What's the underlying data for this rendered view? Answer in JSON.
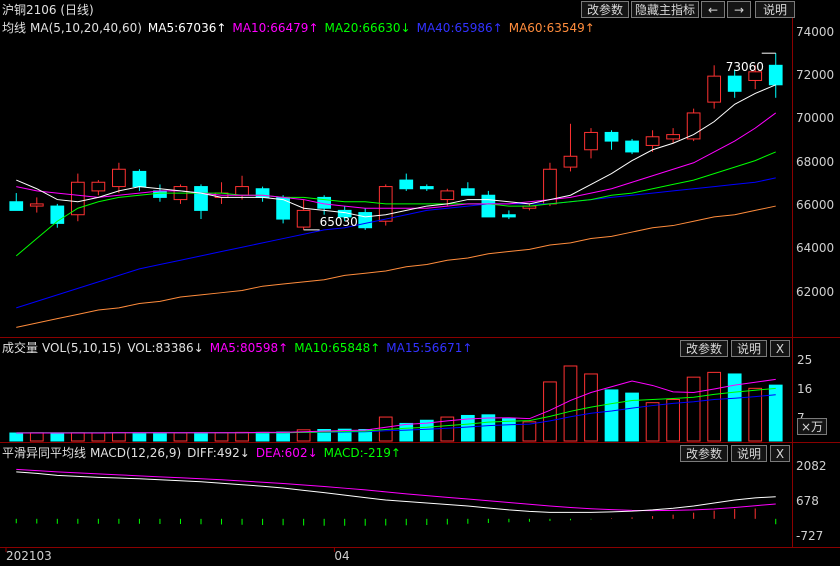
{
  "header": {
    "title": "沪铜2106 (日线)",
    "buttons": {
      "params": "改参数",
      "hide_main": "隐藏主指标",
      "prev": "←",
      "next": "→",
      "help": "说明"
    }
  },
  "price_panel": {
    "ma_legend": {
      "label": "均线",
      "name": "MA(5,10,20,40,60)",
      "ma5": "MA5:67036↑",
      "ma10": "MA10:66479↑",
      "ma20": "MA20:66630↓",
      "ma40": "MA40:65986↑",
      "ma60": "MA60:63549↑"
    },
    "y_ticks": [
      "74000",
      "72000",
      "70000",
      "68000",
      "66000",
      "64000",
      "62000"
    ],
    "annotations": {
      "high": "73060",
      "low": "65030"
    }
  },
  "volume_panel": {
    "legend": {
      "label": "成交量",
      "name": "VOL(5,10,15)",
      "vol": "VOL:83386↓",
      "ma5": "MA5:80598↑",
      "ma10": "MA10:65848↑",
      "ma15": "MA15:56671↑"
    },
    "buttons": {
      "params": "改参数",
      "help": "说明",
      "close": "X"
    },
    "y_ticks": [
      "25",
      "16",
      "7"
    ],
    "unit": "×万"
  },
  "macd_panel": {
    "legend": {
      "label": "平滑异同平均线",
      "name": "MACD(12,26,9)",
      "diff": "DIFF:492↓",
      "dea": "DEA:602↓",
      "macd": "MACD:-219↑"
    },
    "buttons": {
      "params": "改参数",
      "help": "说明",
      "close": "X"
    },
    "y_ticks": [
      "2082",
      "678",
      "-727"
    ]
  },
  "x_axis": {
    "labels": [
      "202103",
      "04"
    ]
  },
  "colors": {
    "up": "#ff3232",
    "down": "#00ffff",
    "ma5": "#ffffff",
    "ma10": "#ff00ff",
    "ma20": "#00ff00",
    "ma40": "#0000ff",
    "ma60": "#ff8c3c",
    "grid": "#8a0000"
  },
  "chart_data": {
    "type": "candlestick",
    "title": "沪铜2106 (日线)",
    "y_range": [
      60000,
      74500
    ],
    "candles": [
      {
        "o": 66200,
        "h": 66600,
        "l": 65800,
        "c": 65800
      },
      {
        "o": 66000,
        "h": 66400,
        "l": 65700,
        "c": 66100
      },
      {
        "o": 66000,
        "h": 66100,
        "l": 65000,
        "c": 65200
      },
      {
        "o": 65600,
        "h": 67500,
        "l": 65300,
        "c": 67100
      },
      {
        "o": 66700,
        "h": 67200,
        "l": 66500,
        "c": 67100
      },
      {
        "o": 66900,
        "h": 68000,
        "l": 66600,
        "c": 67700
      },
      {
        "o": 67600,
        "h": 67700,
        "l": 66700,
        "c": 66900
      },
      {
        "o": 66700,
        "h": 67000,
        "l": 66200,
        "c": 66400
      },
      {
        "o": 66300,
        "h": 67000,
        "l": 66100,
        "c": 66900
      },
      {
        "o": 66900,
        "h": 67000,
        "l": 65400,
        "c": 65800
      },
      {
        "o": 66400,
        "h": 67100,
        "l": 66100,
        "c": 66600
      },
      {
        "o": 66500,
        "h": 67400,
        "l": 66300,
        "c": 66900
      },
      {
        "o": 66800,
        "h": 66900,
        "l": 66200,
        "c": 66400
      },
      {
        "o": 66400,
        "h": 66500,
        "l": 65200,
        "c": 65400
      },
      {
        "o": 65030,
        "h": 66300,
        "l": 64900,
        "c": 65800
      },
      {
        "o": 66400,
        "h": 66500,
        "l": 65600,
        "c": 65900
      },
      {
        "o": 65800,
        "h": 66000,
        "l": 65300,
        "c": 65500
      },
      {
        "o": 65700,
        "h": 65900,
        "l": 64900,
        "c": 65000
      },
      {
        "o": 65300,
        "h": 67000,
        "l": 65100,
        "c": 66900
      },
      {
        "o": 67200,
        "h": 67500,
        "l": 66700,
        "c": 66800
      },
      {
        "o": 66900,
        "h": 67000,
        "l": 66700,
        "c": 66800
      },
      {
        "o": 66300,
        "h": 66800,
        "l": 66000,
        "c": 66700
      },
      {
        "o": 66800,
        "h": 67100,
        "l": 66500,
        "c": 66500
      },
      {
        "o": 66500,
        "h": 66700,
        "l": 65500,
        "c": 65500
      },
      {
        "o": 65600,
        "h": 65800,
        "l": 65400,
        "c": 65500
      },
      {
        "o": 65900,
        "h": 66100,
        "l": 65800,
        "c": 66000
      },
      {
        "o": 66100,
        "h": 68000,
        "l": 66000,
        "c": 67700
      },
      {
        "o": 67800,
        "h": 69800,
        "l": 67600,
        "c": 68300
      },
      {
        "o": 68600,
        "h": 69600,
        "l": 68200,
        "c": 69400
      },
      {
        "o": 69400,
        "h": 69500,
        "l": 68600,
        "c": 69000
      },
      {
        "o": 69000,
        "h": 69100,
        "l": 68400,
        "c": 68500
      },
      {
        "o": 68800,
        "h": 69500,
        "l": 68500,
        "c": 69200
      },
      {
        "o": 69100,
        "h": 69600,
        "l": 68900,
        "c": 69300
      },
      {
        "o": 69100,
        "h": 70500,
        "l": 69000,
        "c": 70300
      },
      {
        "o": 70800,
        "h": 72500,
        "l": 70500,
        "c": 72000
      },
      {
        "o": 72000,
        "h": 72300,
        "l": 71000,
        "c": 71300
      },
      {
        "o": 71800,
        "h": 72500,
        "l": 71400,
        "c": 72200
      },
      {
        "o": 72500,
        "h": 73060,
        "l": 71000,
        "c": 71600
      }
    ],
    "ma5": [
      67200,
      66800,
      66300,
      66200,
      66400,
      66700,
      66900,
      66800,
      66700,
      66600,
      66400,
      66400,
      66400,
      66300,
      65900,
      65800,
      65700,
      65500,
      65600,
      65800,
      66000,
      66100,
      66300,
      66300,
      66200,
      66100,
      66300,
      66500,
      67000,
      67500,
      68100,
      68600,
      68900,
      69300,
      69900,
      70700,
      71200,
      71600
    ],
    "ma10": [
      66900,
      66700,
      66600,
      66500,
      66400,
      66500,
      66600,
      66700,
      66700,
      66600,
      66500,
      66500,
      66500,
      66400,
      66300,
      66100,
      66000,
      65900,
      65900,
      65900,
      65900,
      66000,
      66100,
      66100,
      66100,
      66200,
      66300,
      66400,
      66600,
      66800,
      67100,
      67400,
      67700,
      68000,
      68500,
      69000,
      69600,
      70300
    ],
    "ma20": [
      63700,
      64500,
      65300,
      65900,
      66200,
      66400,
      66500,
      66600,
      66600,
      66600,
      66600,
      66500,
      66500,
      66400,
      66400,
      66300,
      66200,
      66200,
      66100,
      66100,
      66100,
      66100,
      66100,
      66100,
      66000,
      66000,
      66100,
      66200,
      66300,
      66500,
      66600,
      66800,
      67000,
      67200,
      67500,
      67800,
      68100,
      68500
    ],
    "ma40": [
      61300,
      61600,
      61900,
      62200,
      62500,
      62800,
      63100,
      63300,
      63500,
      63700,
      63900,
      64100,
      64300,
      64500,
      64700,
      64900,
      65000,
      65200,
      65400,
      65600,
      65800,
      65900,
      66000,
      66100,
      66100,
      66100,
      66100,
      66200,
      66300,
      66400,
      66500,
      66600,
      66700,
      66800,
      66900,
      67000,
      67100,
      67300
    ],
    "ma60": [
      60400,
      60600,
      60800,
      61000,
      61200,
      61300,
      61500,
      61600,
      61800,
      61900,
      62000,
      62100,
      62300,
      62400,
      62500,
      62600,
      62800,
      62900,
      63000,
      63200,
      63300,
      63500,
      63600,
      63800,
      63900,
      64000,
      64200,
      64300,
      64500,
      64600,
      64800,
      65000,
      65100,
      65300,
      65500,
      65600,
      65800,
      66000
    ],
    "volume": {
      "unit": "万",
      "y_range": [
        0,
        26
      ],
      "values": [
        2.5,
        2.6,
        2.5,
        2.6,
        2.5,
        2.6,
        2.5,
        2.5,
        2.5,
        2.6,
        2.6,
        2.7,
        2.7,
        2.8,
        3.5,
        3.6,
        3.7,
        3.6,
        7.5,
        5.5,
        6.5,
        7.5,
        8.0,
        8.2,
        7.0,
        6.0,
        18.5,
        23.5,
        21.0,
        16.0,
        15.0,
        12.0,
        13.0,
        20.0,
        21.5,
        21.0,
        16.5,
        17.5
      ],
      "ma5": [
        2.5,
        2.5,
        2.5,
        2.5,
        2.5,
        2.6,
        2.6,
        2.6,
        2.6,
        2.6,
        2.6,
        2.6,
        2.7,
        2.7,
        2.9,
        3.1,
        3.3,
        3.4,
        4.3,
        5.2,
        5.6,
        6.3,
        6.9,
        7.2,
        7.3,
        7.0,
        9.6,
        12.7,
        15.2,
        17.0,
        18.8,
        17.4,
        15.4,
        15.2,
        16.3,
        17.5,
        18.4,
        19.3
      ],
      "ma10": [
        2.6,
        2.6,
        2.6,
        2.6,
        2.6,
        2.6,
        2.6,
        2.6,
        2.6,
        2.6,
        2.6,
        2.6,
        2.6,
        2.6,
        2.7,
        2.8,
        3.0,
        3.1,
        3.6,
        4.0,
        4.3,
        4.8,
        5.3,
        5.9,
        6.2,
        6.4,
        7.7,
        9.3,
        10.6,
        11.7,
        12.7,
        13.0,
        13.3,
        13.7,
        14.6,
        15.3,
        15.9,
        16.5
      ],
      "ma15": [
        2.6,
        2.6,
        2.6,
        2.6,
        2.6,
        2.6,
        2.6,
        2.6,
        2.6,
        2.6,
        2.6,
        2.6,
        2.6,
        2.6,
        2.7,
        2.7,
        2.8,
        2.9,
        3.2,
        3.4,
        3.7,
        4.0,
        4.4,
        4.8,
        5.1,
        5.3,
        6.3,
        7.6,
        8.7,
        9.4,
        10.3,
        11.1,
        11.8,
        12.3,
        13.0,
        13.4,
        13.9,
        14.5
      ]
    },
    "macd": {
      "y_range": [
        -1100,
        2300
      ],
      "diff": [
        1900,
        1840,
        1760,
        1720,
        1680,
        1650,
        1620,
        1580,
        1540,
        1500,
        1440,
        1380,
        1320,
        1250,
        1150,
        1060,
        960,
        860,
        760,
        700,
        640,
        580,
        520,
        440,
        360,
        300,
        260,
        260,
        260,
        280,
        310,
        360,
        430,
        520,
        640,
        760,
        850,
        892
      ],
      "dea": [
        2000,
        1950,
        1900,
        1860,
        1820,
        1780,
        1740,
        1700,
        1660,
        1620,
        1580,
        1530,
        1480,
        1430,
        1370,
        1310,
        1240,
        1170,
        1090,
        1010,
        940,
        870,
        800,
        730,
        660,
        590,
        520,
        460,
        410,
        370,
        340,
        330,
        340,
        360,
        400,
        460,
        530,
        602
      ],
      "hist": [
        -180,
        -190,
        -200,
        -200,
        -200,
        -200,
        -200,
        -210,
        -210,
        -220,
        -230,
        -240,
        -250,
        -260,
        -270,
        -280,
        -280,
        -280,
        -270,
        -260,
        -250,
        -230,
        -200,
        -170,
        -140,
        -120,
        -90,
        -60,
        -20,
        20,
        60,
        110,
        170,
        250,
        330,
        400,
        420,
        -219
      ]
    },
    "x_labels": [
      {
        "label": "202103",
        "index": 0
      },
      {
        "label": "04",
        "index": 16
      }
    ]
  }
}
